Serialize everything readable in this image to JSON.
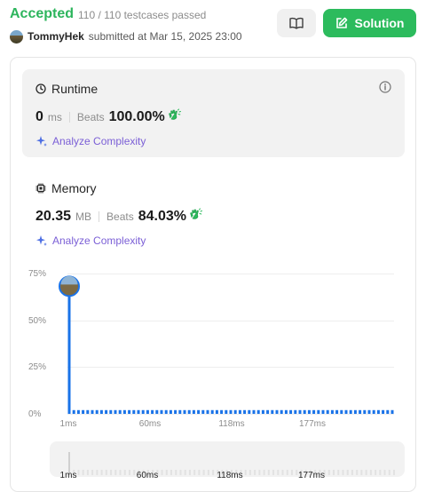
{
  "header": {
    "status": "Accepted",
    "testcases": "110 / 110 testcases passed",
    "username": "TommyHek",
    "submitted_text": "submitted at Mar 15, 2025 23:00",
    "solution_label": "Solution",
    "accent_color": "#2cbb5d"
  },
  "runtime": {
    "title": "Runtime",
    "value": "0",
    "unit": "ms",
    "beats_label": "Beats",
    "beats_value": "100.00%",
    "analyze_label": "Analyze Complexity",
    "icon": "clock-icon"
  },
  "memory": {
    "title": "Memory",
    "value": "20.35",
    "unit": "MB",
    "beats_label": "Beats",
    "beats_value": "84.03%",
    "analyze_label": "Analyze Complexity",
    "icon": "chip-icon"
  },
  "chart_data": {
    "type": "bar",
    "title": "",
    "xlabel": "",
    "ylabel": "",
    "y_tick_labels": [
      "75%",
      "50%",
      "25%",
      "0%"
    ],
    "ylim": [
      0,
      75
    ],
    "x_tick_labels": [
      "1ms",
      "60ms",
      "118ms",
      "177ms"
    ],
    "x_tick_values": [
      1,
      60,
      118,
      177
    ],
    "highlight": {
      "x": 1,
      "y": 72
    },
    "bar_count": 71,
    "bar_values": [
      72,
      2,
      2,
      2,
      2,
      2,
      2,
      2,
      2,
      2,
      2,
      2,
      2,
      2,
      2,
      2,
      2,
      2,
      2,
      2,
      2,
      2,
      2,
      2,
      2,
      2,
      2,
      2,
      2,
      2,
      2,
      2,
      2,
      2,
      2,
      2,
      2,
      2,
      2,
      2,
      2,
      2,
      2,
      2,
      2,
      2,
      2,
      2,
      2,
      2,
      2,
      2,
      2,
      2,
      2,
      2,
      2,
      2,
      2,
      2,
      2,
      2,
      2,
      2,
      2,
      2,
      2,
      2,
      2,
      2,
      2
    ],
    "bar_color": "#1a73e8",
    "grid": true
  },
  "scrubber": {
    "x_tick_labels": [
      "1ms",
      "60ms",
      "118ms",
      "177ms"
    ]
  }
}
